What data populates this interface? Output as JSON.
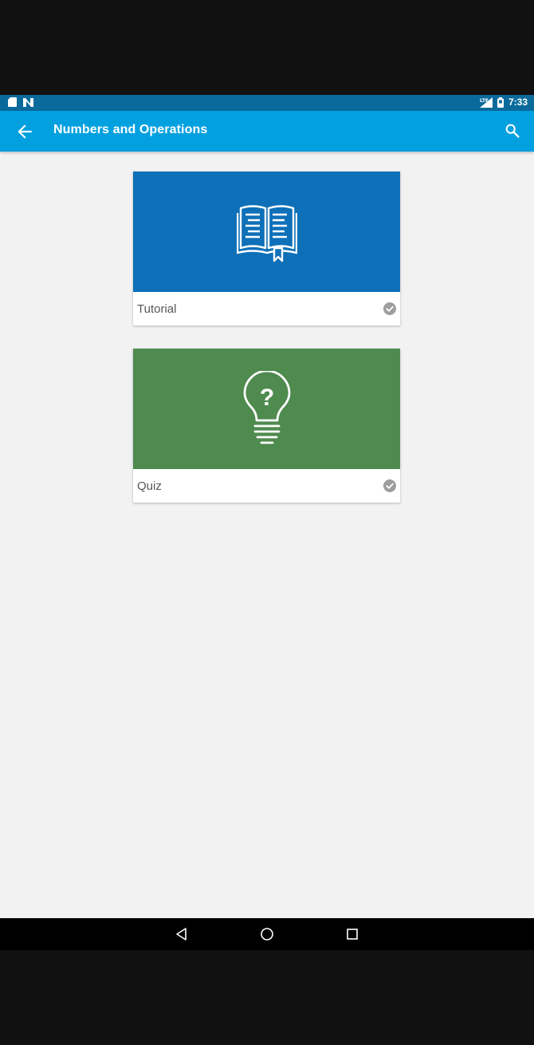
{
  "status_bar": {
    "time": "7:33",
    "left_icons": [
      "sd-card-icon",
      "n-notification-icon"
    ],
    "right_icons": [
      "signal-icon",
      "battery-icon"
    ]
  },
  "app_bar": {
    "title": "Numbers and Operations",
    "back_icon": "arrow-back-icon",
    "search_icon": "search-icon"
  },
  "cards": [
    {
      "label": "Tutorial",
      "banner_color": "#0e70b8",
      "icon": "book-icon",
      "status_icon": "check-circle-icon"
    },
    {
      "label": "Quiz",
      "banner_color": "#4f8a4f",
      "icon": "lightbulb-question-icon",
      "status_icon": "check-circle-icon"
    }
  ],
  "quiz_icon_text": "?",
  "nav_bar": {
    "icons": [
      "back-triangle-icon",
      "home-circle-icon",
      "recents-square-icon"
    ]
  },
  "colors": {
    "status_bar": "#0a6a9c",
    "app_bar": "#03a0e0",
    "background": "#f2f2f2",
    "check": "#9e9e9e"
  }
}
